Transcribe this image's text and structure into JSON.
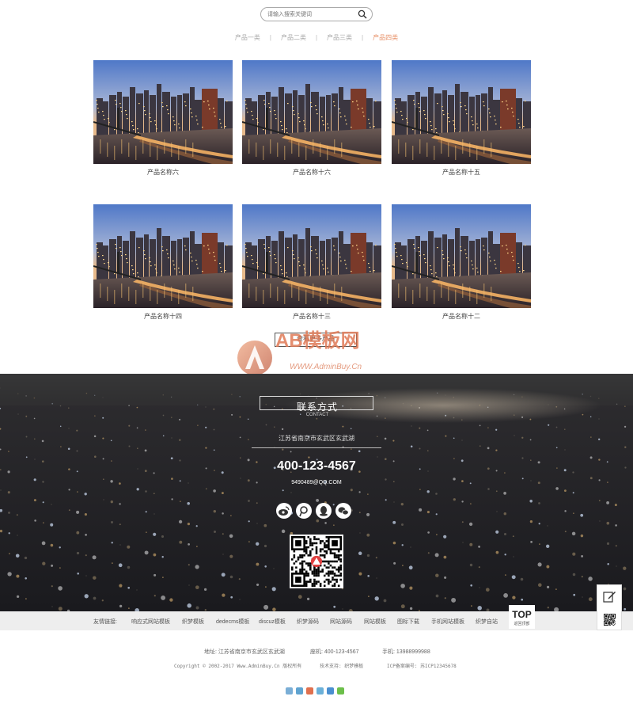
{
  "search": {
    "placeholder": "请输入搜索关键词"
  },
  "categories": [
    "产品一类",
    "产品二类",
    "产品三类",
    "产品四类"
  ],
  "separator": "|",
  "products": [
    {
      "name": "产品名称六"
    },
    {
      "name": "产品名称十六"
    },
    {
      "name": "产品名称十五"
    },
    {
      "name": "产品名称十四"
    },
    {
      "name": "产品名称十三"
    },
    {
      "name": "产品名称十二"
    }
  ],
  "more": {
    "label": "查看更多产品"
  },
  "watermark": {
    "brand": "AB模板网",
    "url": "WWW.AdminBuy.Cn"
  },
  "contact": {
    "title": "联系方式",
    "subtitle": "CONTACT",
    "address": "江苏省南京市玄武区玄武湖",
    "phone": "400-123-4567",
    "email": "9490489@QQ.COM"
  },
  "social_icons": [
    "weibo-icon",
    "tencent-weibo-icon",
    "qq-icon",
    "wechat-icon"
  ],
  "links": {
    "label": "友情链接:",
    "items": [
      "响应式网站模板",
      "织梦模板",
      "dedecms模板",
      "discuz模板",
      "织梦源码",
      "网站源码",
      "网站模板",
      "图标下载",
      "手机网站模板",
      "织梦自站"
    ]
  },
  "top_button": {
    "label": "TOP",
    "sub": "返回顶部"
  },
  "footer": {
    "address": "地址: 江苏省南京市玄武区玄武湖",
    "tel": "座机: 400-123-4567",
    "mobile": "手机: 13988999988",
    "copyright": "Copyright © 2002-2017 Www.AdminBuy.Cn 版权所有",
    "tech": "技术支持: 织梦模板",
    "icp": "ICP备案编号: 苏ICP12345678"
  },
  "colors": {
    "accent": "#e8926a",
    "dark_bg": "#2a2a2a",
    "link_bar": "#eeeeee"
  }
}
